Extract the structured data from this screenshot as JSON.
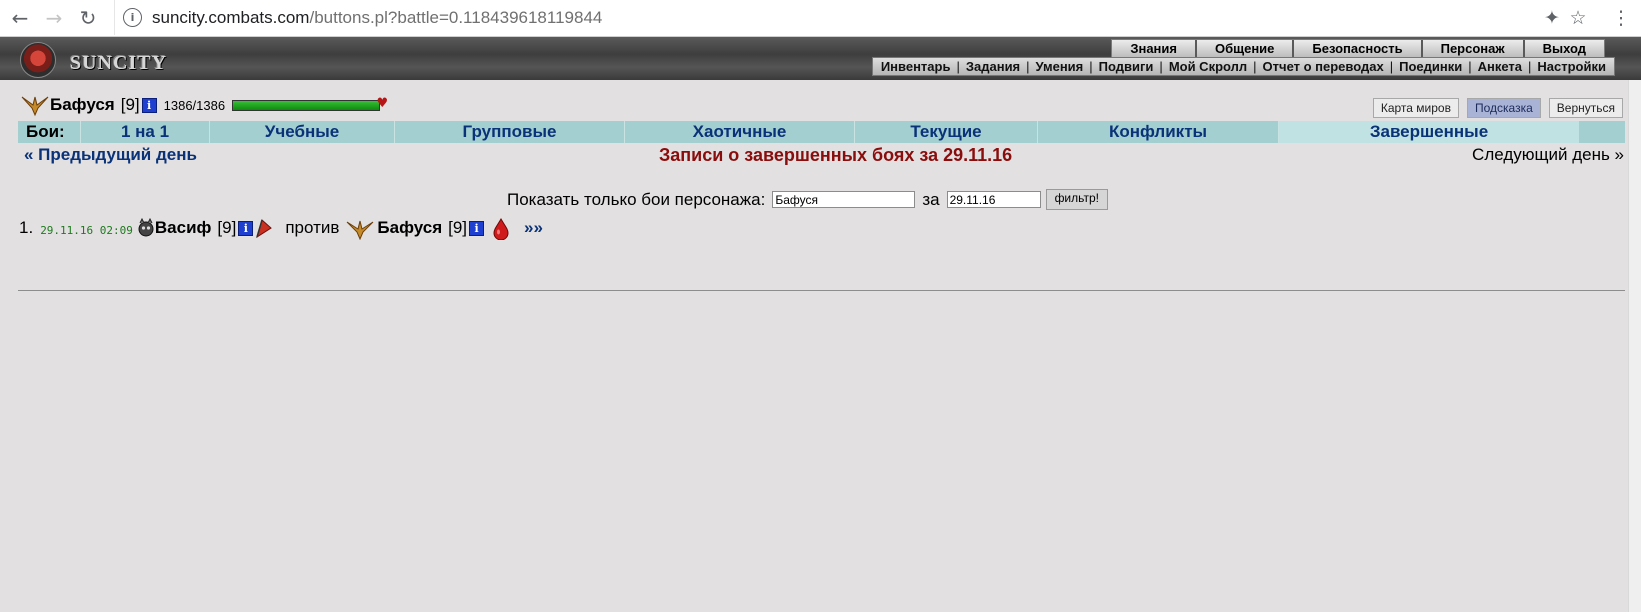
{
  "browser": {
    "url_host": "suncity.combats.com",
    "url_path": "/buttons.pl?battle=0.118439618119844",
    "back_icon": "arrow-left-icon",
    "forward_icon": "arrow-right-icon",
    "reload_icon": "reload-icon",
    "extension_icon": "puzzle-icon",
    "bookmark_icon": "star-icon",
    "menu_icon": "kebab-menu-icon"
  },
  "header": {
    "logo_text": "SUNCITY",
    "top_menu": [
      "Знания",
      "Общение",
      "Безопасность",
      "Персонаж",
      "Выход"
    ],
    "sub_menu": [
      "Инвентарь",
      "Задания",
      "Умения",
      "Подвиги",
      "Мой Скролл",
      "Отчет о переводах",
      "Поединки",
      "Анкета",
      "Настройки"
    ]
  },
  "player": {
    "name": "Бафуся",
    "level": "[9]",
    "hp_text": "1386/1386",
    "hp_fraction": 1.0,
    "info_glyph": "i"
  },
  "actions": {
    "world_map": "Карта миров",
    "hint": "Подсказка",
    "back": "Вернуться"
  },
  "tabs": {
    "lead": "Бои:",
    "items": [
      "1 на 1",
      "Учебные",
      "Групповые",
      "Хаотичные",
      "Текущие",
      "Конфликты",
      "Завершенные"
    ],
    "selected": "Завершенные"
  },
  "daynav": {
    "prev": "« Предыдущий день",
    "title": "Записи о завершенных боях за 29.11.16",
    "next": "Следующий день »"
  },
  "filter": {
    "label": "Показать только бои персонажа:",
    "name_value": "Бафуся",
    "for_label": "за",
    "date_value": "29.11.16",
    "button": "фильтр!"
  },
  "battles": [
    {
      "index": "1.",
      "time": "29.11.16 02:09",
      "player1_name": "Васиф",
      "player1_level": "[9]",
      "versus": "против",
      "player2_name": "Бафуся",
      "player2_level": "[9]",
      "more": "»»"
    }
  ]
}
